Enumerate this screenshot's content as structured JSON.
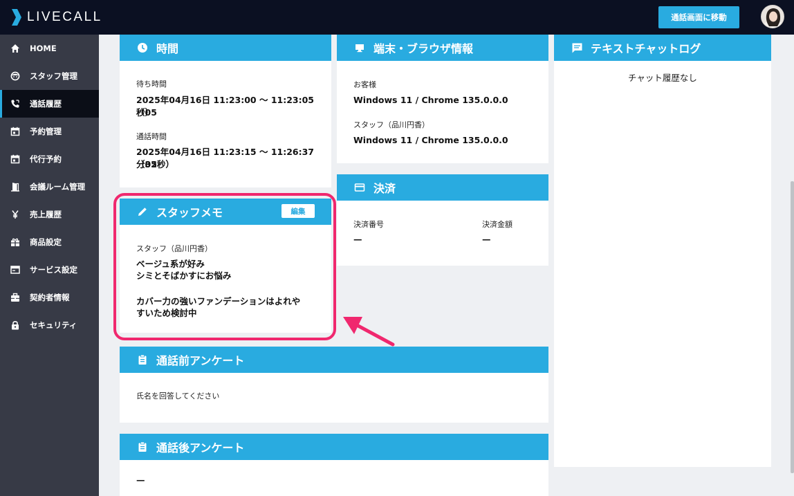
{
  "app": {
    "logo_text": "LIVECALL",
    "top_button": "通話画面に移動",
    "accent": "#29abe0"
  },
  "sidebar": {
    "items": [
      {
        "label": "HOME",
        "icon": "home-icon"
      },
      {
        "label": "スタッフ管理",
        "icon": "staff-face-icon"
      },
      {
        "label": "通話履歴",
        "icon": "phone-icon",
        "active": true
      },
      {
        "label": "予約管理",
        "icon": "calendar-icon"
      },
      {
        "label": "代行予約",
        "icon": "calendar-check-icon"
      },
      {
        "label": "会議ルーム管理",
        "icon": "door-icon"
      },
      {
        "label": "売上履歴",
        "icon": "yen-icon"
      },
      {
        "label": "商品設定",
        "icon": "gift-icon"
      },
      {
        "label": "サービス設定",
        "icon": "card-window-icon"
      },
      {
        "label": "契約者情報",
        "icon": "briefcase-icon"
      },
      {
        "label": "セキュリティ",
        "icon": "lock-icon"
      }
    ]
  },
  "time_card": {
    "title": "時間",
    "wait_label": "待ち時間",
    "wait_line1": "2025年04月16日 11:23:00 〜 11:23:05（05",
    "wait_line2": "秒）",
    "call_label": "通話時間",
    "call_line1": "2025年04月16日 11:23:15 〜 11:26:37（02",
    "call_line2": "分35秒）"
  },
  "device_card": {
    "title": "端末・ブラウザ情報",
    "customer_label": "お客様",
    "customer_value": "Windows 11 / Chrome 135.0.0.0",
    "staff_label": "スタッフ（品川円香）",
    "staff_value": "Windows 11 / Chrome 135.0.0.0"
  },
  "chat_card": {
    "title": "テキストチャットログ",
    "empty_text": "チャット履歴なし"
  },
  "payment_card": {
    "title": "決済",
    "number_label": "決済番号",
    "number_value": "—",
    "amount_label": "決済金額",
    "amount_value": "—"
  },
  "memo_card": {
    "title": "スタッフメモ",
    "edit_label": "編集",
    "author": "スタッフ（品川円香）",
    "lines": [
      "ベージュ系が好み",
      "シミとそばかすにお悩み",
      "カバー力の強いファンデーションはよれや",
      "すいため検討中"
    ]
  },
  "pre_survey": {
    "title": "通話前アンケート",
    "text": "氏名を回答してください"
  },
  "post_survey": {
    "title": "通話後アンケート",
    "text": "—"
  },
  "annotation": {
    "highlight_color": "#f0286e"
  }
}
